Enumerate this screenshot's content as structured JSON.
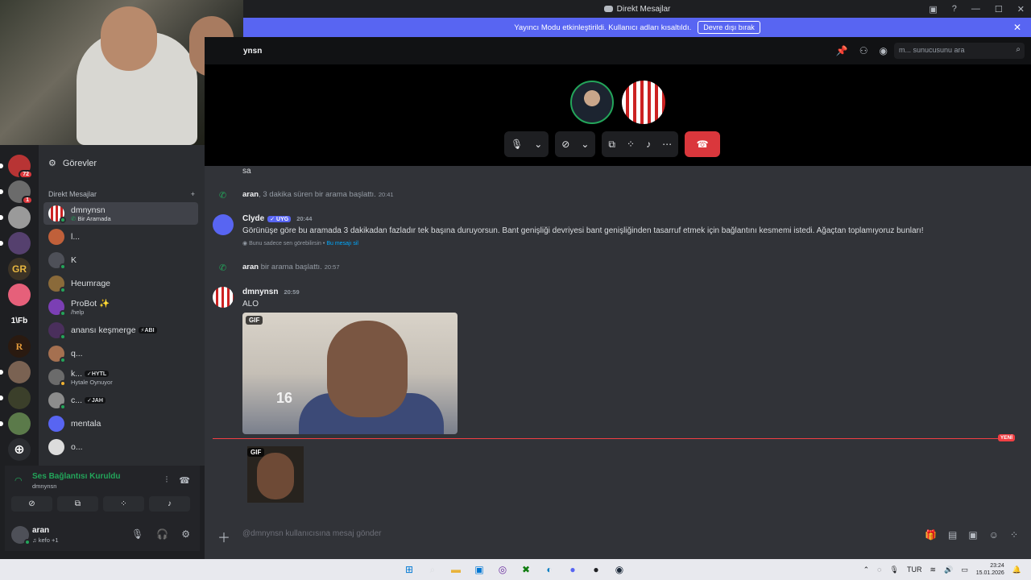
{
  "window": {
    "title": "Direkt Mesajlar",
    "controls": [
      "—",
      "☐",
      "✕"
    ]
  },
  "banner": {
    "message": "Yayıncı Modu etkinleştirildi. Kullanıcı adları kısaltıldı.",
    "button": "Devre dışı bırak"
  },
  "header": {
    "channel_name": "ynsn",
    "search_placeholder": "m... sunucusunu ara"
  },
  "call": {
    "hangup_color": "#da373c"
  },
  "rail": {
    "badges": [
      "72",
      "1"
    ],
    "initials": [
      "GR",
      "1\\Fb",
      "R"
    ]
  },
  "sidebar": {
    "tasks_label": "Görevler",
    "dm_header": "Direkt Mesajlar",
    "dm_add": "+",
    "items": [
      {
        "name": "dmnynsn",
        "sub": "Bir Aramada",
        "tag": ""
      },
      {
        "name": "l...",
        "sub": "",
        "tag": ""
      },
      {
        "name": "K",
        "sub": "",
        "tag": ""
      },
      {
        "name": "Heumrage",
        "sub": "",
        "tag": ""
      },
      {
        "name": "ProBot ✨",
        "sub": "/help",
        "tag": ""
      },
      {
        "name": "anansı keşmerge",
        "sub": "",
        "tag": "ABI"
      },
      {
        "name": "q...",
        "sub": "",
        "tag": ""
      },
      {
        "name": "k...",
        "sub": "Hytale Oynuyor",
        "tag": "HYTL"
      },
      {
        "name": "c...",
        "sub": "",
        "tag": "JAH"
      },
      {
        "name": "mentala",
        "sub": "",
        "tag": ""
      },
      {
        "name": "o...",
        "sub": "",
        "tag": ""
      }
    ]
  },
  "voice": {
    "title": "Ses Bağlantısı Kuruldu",
    "sub": "dmnynsn"
  },
  "user": {
    "name": "aran",
    "sub": "♫ kefo +1"
  },
  "chat": {
    "top_text": "sa",
    "call1_user": "aran",
    "call1_text": ", 3 dakika süren bir arama başlattı.",
    "call1_time": "20:41",
    "clyde_name": "Clyde",
    "clyde_badge": "✓ UYG",
    "clyde_time": "20:44",
    "clyde_text": "Görünüşe göre bu aramada 3 dakikadan fazladır tek başına duruyorsun. Bant genişliği devriyesi bant genişliğinden tasarruf etmek için bağlantını kesmemi istedi. Ağaçtan toplamıyoruz bunları!",
    "ephemeral_text": "Bunu sadece sen görebilirsin •",
    "ephemeral_link": "Bu mesajı sil",
    "call2_user": "aran",
    "call2_text": " bir arama başlattı.",
    "call2_time": "20:57",
    "msg_user": "dmnynsn",
    "msg_time": "20:59",
    "msg_text": "ALO",
    "gif_label": "GIF",
    "gif_num": "16",
    "new_label": "YENİ"
  },
  "composer": {
    "placeholder": "@dmnynsn kullanıcısına mesaj gönder"
  },
  "taskbar": {
    "lang": "TUR",
    "time": "23:24",
    "date": "15.01.2026"
  }
}
